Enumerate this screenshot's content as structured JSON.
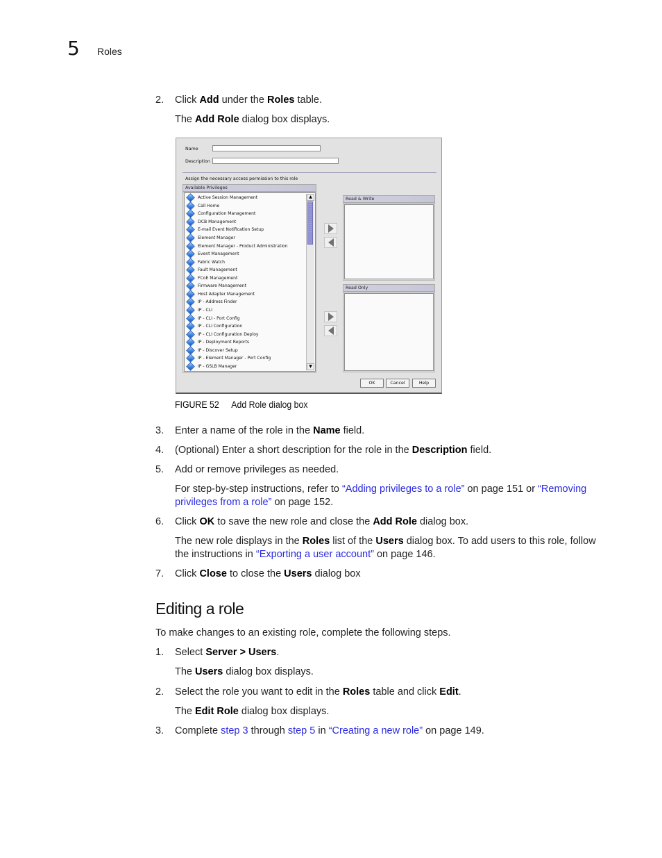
{
  "header": {
    "chapter_number": "5",
    "chapter_title": "Roles"
  },
  "steps_a": [
    {
      "num": "2.",
      "parts": [
        [
          "t",
          "Click "
        ],
        [
          "b",
          "Add"
        ],
        [
          "t",
          " under the "
        ],
        [
          "b",
          "Roles"
        ],
        [
          "t",
          " table."
        ]
      ]
    }
  ],
  "para_add_role_displays": [
    [
      "t",
      "The "
    ],
    [
      "b",
      "Add Role"
    ],
    [
      "t",
      " dialog box displays."
    ]
  ],
  "dialog": {
    "name_label": "Name",
    "name_value": "",
    "description_label": "Description",
    "description_value": "",
    "assign_text": "Assign the necessary access permission to this role",
    "available_header": "Available Privileges",
    "privileges": [
      "Active Session Management",
      "Call Home",
      "Configuration Management",
      "DCB Management",
      "E-mail Event Notification Setup",
      "Element Manager",
      "Element Manager - Product Administration",
      "Event Management",
      "Fabric Watch",
      "Fault Management",
      "FCoE Management",
      "Firmware Management",
      "Host Adapter Management",
      "IP - Address Finder",
      "IP - CLI",
      "IP - CLI - Port Config",
      "IP - CLI Configuration",
      "IP - CLI Configuration Deploy",
      "IP - Deployment Reports",
      "IP - Discover Setup",
      "IP - Element Manager - Port Config",
      "IP - GSLB Manager"
    ],
    "read_write_header": "Read & Write",
    "read_only_header": "Read Only",
    "ok_label": "OK",
    "cancel_label": "Cancel",
    "help_label": "Help",
    "scroll_up_glyph": "▲",
    "scroll_down_glyph": "▼"
  },
  "figure": {
    "number": "FIGURE 52",
    "caption": "Add Role dialog box"
  },
  "steps_b": [
    {
      "num": "3.",
      "parts": [
        [
          "t",
          "Enter a name of the role in the "
        ],
        [
          "b",
          "Name"
        ],
        [
          "t",
          " field."
        ]
      ]
    },
    {
      "num": "4.",
      "parts": [
        [
          "t",
          "(Optional) Enter a short description for the role in the "
        ],
        [
          "b",
          "Description"
        ],
        [
          "t",
          " field."
        ]
      ]
    },
    {
      "num": "5.",
      "parts": [
        [
          "t",
          "Add or remove privileges as needed."
        ]
      ]
    }
  ],
  "para_refer": [
    [
      "t",
      "For step-by-step instructions, refer to "
    ],
    [
      "l",
      "“Adding privileges to a role”"
    ],
    [
      "t",
      " on page 151 or "
    ],
    [
      "l",
      "“Removing privileges from a role”"
    ],
    [
      "t",
      " on page 152."
    ]
  ],
  "step6": {
    "num": "6.",
    "parts": [
      [
        "t",
        "Click "
      ],
      [
        "b",
        "OK"
      ],
      [
        "t",
        " to save the new role and close the "
      ],
      [
        "b",
        "Add Role"
      ],
      [
        "t",
        " dialog box."
      ]
    ]
  },
  "para_new_role": [
    [
      "t",
      "The new role displays in the "
    ],
    [
      "b",
      "Roles"
    ],
    [
      "t",
      " list of the "
    ],
    [
      "b",
      "Users"
    ],
    [
      "t",
      " dialog box. To add users to this role, follow the instructions in "
    ],
    [
      "l",
      "“Exporting a user account”"
    ],
    [
      "t",
      " on page 146."
    ]
  ],
  "step7": {
    "num": "7.",
    "parts": [
      [
        "t",
        "Click "
      ],
      [
        "b",
        "Close"
      ],
      [
        "t",
        " to close the "
      ],
      [
        "b",
        "Users"
      ],
      [
        "t",
        " dialog box"
      ]
    ]
  },
  "section_heading": "Editing a role",
  "section_intro": "To make changes to an existing role, complete the following steps.",
  "edit_step1": {
    "num": "1.",
    "parts": [
      [
        "t",
        "Select "
      ],
      [
        "b",
        "Server > Users"
      ],
      [
        "t",
        "."
      ]
    ]
  },
  "edit_para1": [
    [
      "t",
      "The "
    ],
    [
      "b",
      "Users"
    ],
    [
      "t",
      " dialog box displays."
    ]
  ],
  "edit_step2": {
    "num": "2.",
    "parts": [
      [
        "t",
        "Select the role you want to edit in the "
      ],
      [
        "b",
        "Roles"
      ],
      [
        "t",
        " table and click "
      ],
      [
        "b",
        "Edit"
      ],
      [
        "t",
        "."
      ]
    ]
  },
  "edit_para2": [
    [
      "t",
      "The "
    ],
    [
      "b",
      "Edit Role"
    ],
    [
      "t",
      " dialog box displays."
    ]
  ],
  "edit_step3": {
    "num": "3.",
    "parts": [
      [
        "t",
        "Complete "
      ],
      [
        "l",
        "step 3"
      ],
      [
        "t",
        " through "
      ],
      [
        "l",
        "step 5"
      ],
      [
        "t",
        " in "
      ],
      [
        "l",
        "“Creating a new role”"
      ],
      [
        "t",
        " on page 149."
      ]
    ]
  },
  "colors": {
    "link": "#2a2ae0",
    "text": "#222222",
    "dialog_bg": "#e2e2e2",
    "scroll_thumb": "#8e8ed2"
  }
}
